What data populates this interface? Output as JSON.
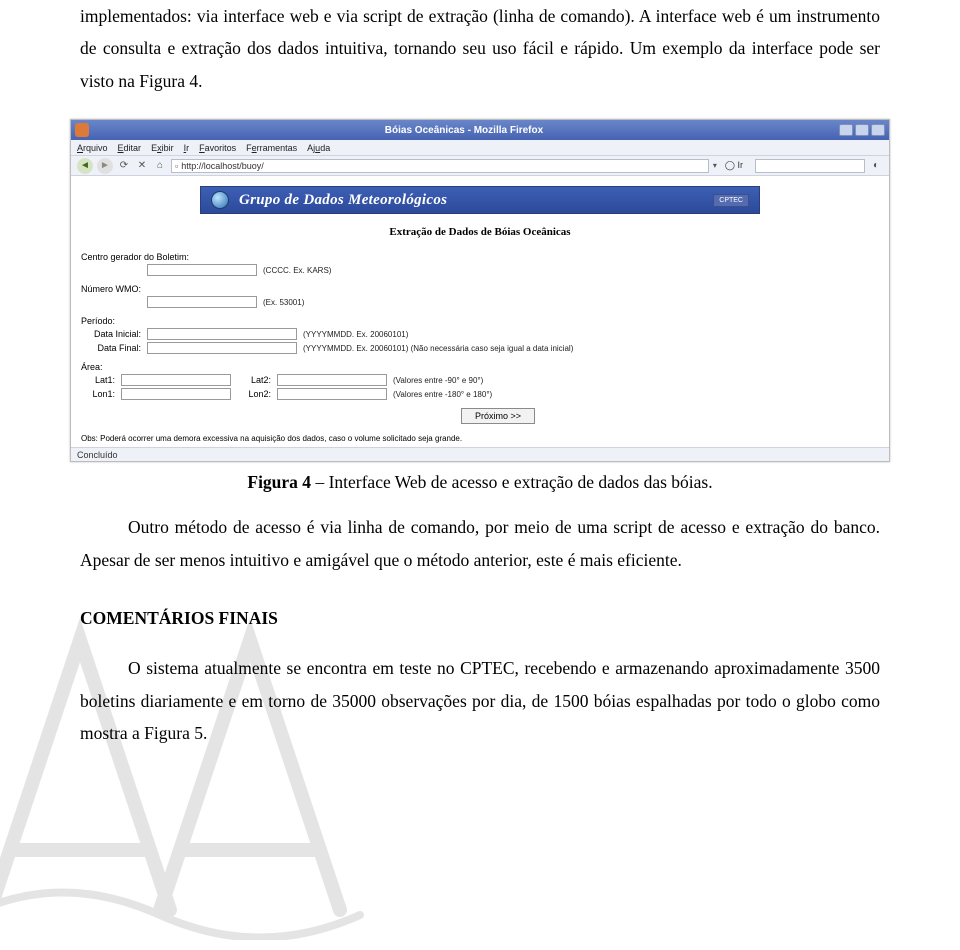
{
  "paragraph1": "implementados: via interface web e via script de extração (linha de comando). A interface web é um instrumento de consulta e extração dos dados intuitiva, tornando seu uso fácil e rápido. Um exemplo da interface pode ser visto na Figura 4.",
  "screenshot": {
    "window_title": "Bóias Oceânicas - Mozilla Firefox",
    "menu": {
      "arquivo": "Arquivo",
      "editar": "Editar",
      "exibir": "Exibir",
      "ir": "Ir",
      "favoritos": "Favoritos",
      "ferramentas": "Ferramentas",
      "ajuda": "Ajuda"
    },
    "url": "http://localhost/buoy/",
    "go": "Ir",
    "banner_text": "Grupo de Dados Meteorológicos",
    "banner_logo": "CPTEC",
    "page_title": "Extração de Dados de Bóias Oceânicas",
    "centro_label": "Centro gerador do Boletim:",
    "centro_hint": "(CCCC. Ex. KARS)",
    "wmo_label": "Número WMO:",
    "wmo_hint": "(Ex. 53001)",
    "periodo_label": "Período:",
    "data_inicial_label": "Data Inicial:",
    "data_inicial_hint": "(YYYYMMDD. Ex. 20060101)",
    "data_final_label": "Data Final:",
    "data_final_hint": "(YYYYMMDD. Ex. 20060101) (Não necessária caso seja igual a data inicial)",
    "area_label": "Área:",
    "lat1_label": "Lat1:",
    "lat2_label": "Lat2:",
    "lat_hint": "(Valores entre -90° e 90°)",
    "lon1_label": "Lon1:",
    "lon2_label": "Lon2:",
    "lon_hint": "(Valores entre -180° e 180°)",
    "next_btn": "Próximo >>",
    "obs": "Obs: Poderá ocorrer uma demora excessiva na aquisição dos dados, caso o volume solicitado seja grande.",
    "status": "Concluído"
  },
  "fig4_bold": "Figura 4",
  "fig4_rest": " – Interface Web de acesso e extração de dados das bóias.",
  "paragraph2": "Outro método de acesso é via linha de comando, por meio de uma script de acesso e extração do banco. Apesar de ser menos intuitivo e amigável que o método anterior, este é mais eficiente.",
  "section_title": "COMENTÁRIOS FINAIS",
  "paragraph3": "O sistema atualmente se encontra em teste no CPTEC, recebendo e armazenando aproximadamente 3500 boletins diariamente e em torno de 35000 observações por dia, de 1500 bóias espalhadas por todo o globo como mostra a Figura 5."
}
